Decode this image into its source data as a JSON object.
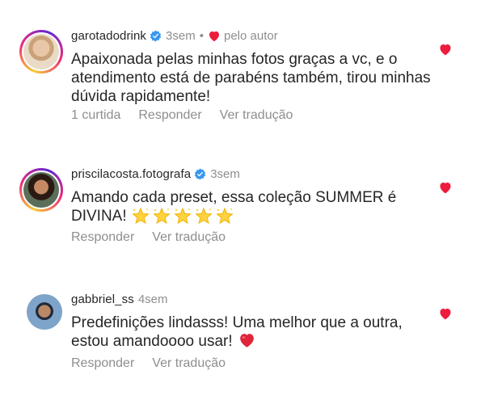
{
  "comments": [
    {
      "username": "garotadodrink",
      "verified": true,
      "time": "3sem",
      "separator": "•",
      "author_liked_label": "pelo autor",
      "text": "Apaixonada pelas minhas fotos graças a vc, e o atendimento está de parabéns também, tirou minhas dúvida rapidamente!",
      "likes_label": "1 curtida",
      "reply_label": "Responder",
      "translate_label": "Ver tradução",
      "liked": true
    },
    {
      "username": "priscilacosta.fotografa",
      "verified": true,
      "time": "3sem",
      "text": "Amando cada preset, essa coleção SUMMER é DIVINA!",
      "emoji": "star-emoji x5",
      "reply_label": "Responder",
      "translate_label": "Ver tradução",
      "liked": true
    },
    {
      "username": "gabbriel_ss",
      "verified": false,
      "time": "4sem",
      "text": "Predefinições lindasss! Uma melhor que a outra, estou amandoooo usar!",
      "emoji": "red-heart-emoji",
      "reply_label": "Responder",
      "translate_label": "Ver tradução",
      "liked": true
    }
  ],
  "colors": {
    "text": "#262626",
    "secondary": "#8e8e8e",
    "like_red": "#ed1c3c",
    "verified_blue": "#3897f0"
  }
}
